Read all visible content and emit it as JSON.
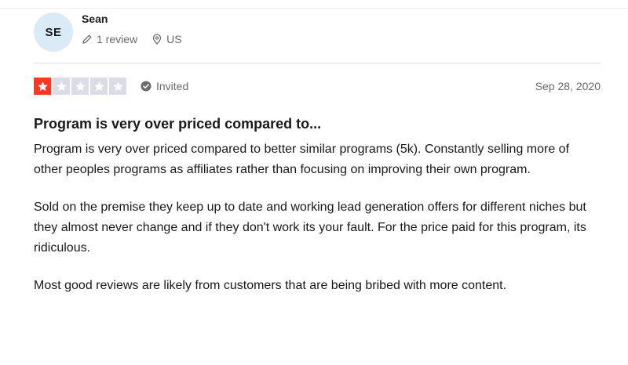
{
  "reviewer": {
    "initials": "SE",
    "name": "Sean",
    "review_count": "1 review",
    "country": "US",
    "avatar_color": "#dbeaf7"
  },
  "review": {
    "rating": 1,
    "max_rating": 5,
    "star_color": "#ff3722",
    "empty_star_color": "#dcdce6",
    "status": "Invited",
    "date": "Sep 28, 2020",
    "title": "Program is very over priced compared to...",
    "paragraphs": [
      "Program is very over priced compared to better similar programs (5k). Constantly selling more of other peoples programs as affiliates rather than focusing on improving their own program.",
      "Sold on the premise they keep up to date and working lead generation offers for different niches but they almost never change and if they don't work its your fault. For the price paid for this program, its ridiculous.",
      "Most good reviews are likely from customers that are being bribed with more content."
    ]
  },
  "icons": {
    "review_count": "pencil-icon",
    "country": "location-pin-icon",
    "status": "check-circle-icon",
    "star": "star-icon"
  }
}
